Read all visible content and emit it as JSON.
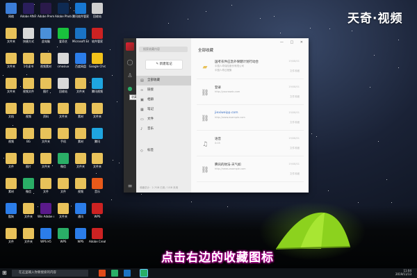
{
  "watermark": "天奇·视频",
  "subtitle": "点击右边的收藏图标",
  "desktop_icons": [
    {
      "label": "网络",
      "color": "#3b7dd8"
    },
    {
      "label": "Adobe After Effects CC 2019",
      "color": "#2a1e5c"
    },
    {
      "label": "Adobe Premiere Pro...",
      "color": "#2a1a4a"
    },
    {
      "label": "Adobe Photosh...",
      "color": "#0e2a52"
    },
    {
      "label": "腾讯软件管家",
      "color": "#1877d2"
    },
    {
      "label": "回收站",
      "color": "#cfcfcf"
    },
    {
      "label": "文件夹",
      "color": "#e8c25a"
    },
    {
      "label": "快捷方式",
      "color": "#d8d8d8"
    },
    {
      "label": "此电脑",
      "color": "#4a90d9"
    },
    {
      "label": "爱奇艺",
      "color": "#19c23d"
    },
    {
      "label": "Microsoft Edge",
      "color": "#1a73c4"
    },
    {
      "label": "软件管家",
      "color": "#c22"
    },
    {
      "label": "文件夹",
      "color": "#e8c25a"
    },
    {
      "label": "1号读书",
      "color": "#e8c25a"
    },
    {
      "label": "视频素材",
      "color": "#e8c25a"
    },
    {
      "label": "cmosiux",
      "color": "#d8d8d8"
    },
    {
      "label": "百度网盘",
      "color": "#2b7de9"
    },
    {
      "label": "Google Chrome",
      "color": "#f2c21a"
    },
    {
      "label": "文件夹",
      "color": "#e8c25a"
    },
    {
      "label": "视频文件",
      "color": "#e8c25a"
    },
    {
      "label": "图片",
      "color": "#e8c25a"
    },
    {
      "label": "回收站",
      "color": "#d8d8d8"
    },
    {
      "label": "文件夹",
      "color": "#e8c25a"
    },
    {
      "label": "腾讯视频",
      "color": "#1fa5e0"
    },
    {
      "label": "文档",
      "color": "#e8c25a"
    },
    {
      "label": "视频",
      "color": "#e8c25a"
    },
    {
      "label": "资料",
      "color": "#e8c25a"
    },
    {
      "label": "文件夹",
      "color": "#e8c25a"
    },
    {
      "label": "素材",
      "color": "#e8c25a"
    },
    {
      "label": "文件夹",
      "color": "#e8c25a"
    },
    {
      "label": "视频",
      "color": "#e8c25a"
    },
    {
      "label": "BG",
      "color": "#e8c25a"
    },
    {
      "label": "文件夹",
      "color": "#e8c25a"
    },
    {
      "label": "手机",
      "color": "#e8c25a"
    },
    {
      "label": "素材",
      "color": "#e8c25a"
    },
    {
      "label": "腾讯",
      "color": "#1fa5e0"
    },
    {
      "label": "文件",
      "color": "#e8c25a"
    },
    {
      "label": "图片",
      "color": "#e8c25a"
    },
    {
      "label": "文件夹",
      "color": "#e8c25a"
    },
    {
      "label": "微信",
      "color": "#2aae67"
    },
    {
      "label": "文件夹",
      "color": "#e8c25a"
    },
    {
      "label": "文件夹",
      "color": "#e8c25a"
    },
    {
      "label": "素材",
      "color": "#e8c25a"
    },
    {
      "label": "微信",
      "color": "#2aae67"
    },
    {
      "label": "文件",
      "color": "#e8c25a"
    },
    {
      "label": "文件",
      "color": "#e8c25a"
    },
    {
      "label": "视频",
      "color": "#e8c25a"
    },
    {
      "label": "音乐",
      "color": "#e85a1a"
    },
    {
      "label": "酷狗",
      "color": "#2b7de9"
    },
    {
      "label": "文件夹",
      "color": "#e8c25a"
    },
    {
      "label": "Win Adobe cc 2019",
      "color": "#5a1a8a"
    },
    {
      "label": "文件夹",
      "color": "#e8c25a"
    },
    {
      "label": "通讯",
      "color": "#2b7de9"
    },
    {
      "label": "WPS",
      "color": "#c22"
    },
    {
      "label": "文件",
      "color": "#e8c25a"
    },
    {
      "label": "文件夹",
      "color": "#e8c25a"
    },
    {
      "label": "WPS H5",
      "color": "#2b7de9"
    },
    {
      "label": "WPS",
      "color": "#2aae67"
    },
    {
      "label": "WPS",
      "color": "#2b7de9"
    },
    {
      "label": "Adobe Creati...",
      "color": "#c22"
    }
  ],
  "window": {
    "search_placeholder": "搜索收藏内容",
    "new_note": "新建笔记",
    "tooltip": "收藏",
    "sidebar": [
      {
        "label": "全部收藏",
        "icon": "▤"
      },
      {
        "label": "链接",
        "icon": "∞"
      },
      {
        "label": "相册",
        "icon": "▣"
      },
      {
        "label": "笔记",
        "icon": "▦"
      },
      {
        "label": "文件",
        "icon": "▭"
      },
      {
        "label": "音乐",
        "icon": "♪"
      },
      {
        "label": "标签",
        "icon": "◇"
      }
    ],
    "footer": "收藏总计：2.7GB 已用 / 1GB 未用",
    "main_title": "全部收藏",
    "window_buttons": "— □ ✕",
    "cards": [
      {
        "title": "国考农件应急外保健计划行动合",
        "sub": "中国人寿保险股份有限公司",
        "sub2": "中国人寿过程集",
        "date": "19/08/01",
        "meta": "文件收藏",
        "icon": "folder",
        "link": false
      },
      {
        "title": "登录",
        "sub": "http://yoursweb.com",
        "sub2": "",
        "date": "19/08/01",
        "meta": "文件收藏",
        "icon": "link",
        "link": false
      },
      {
        "title": "jiexiweipp.com",
        "sub": "http://www.example.com",
        "sub2": "",
        "date": "19/08/01",
        "meta": "文件收藏",
        "icon": "link",
        "link": true
      },
      {
        "title": "语音",
        "sub": "0:05",
        "sub2": "",
        "date": "19/08/01",
        "meta": "文件收藏",
        "icon": "mic",
        "link": false
      },
      {
        "title": "腾讯的财法-天气如",
        "sub": "http://news.example.com",
        "sub2": "",
        "date": "19/08/01",
        "meta": "文件收藏",
        "icon": "link",
        "link": false
      }
    ]
  },
  "taskbar": {
    "search_placeholder": "在这里输入你要搜索的内容",
    "time": "11:04",
    "date": "2019/11/13"
  }
}
